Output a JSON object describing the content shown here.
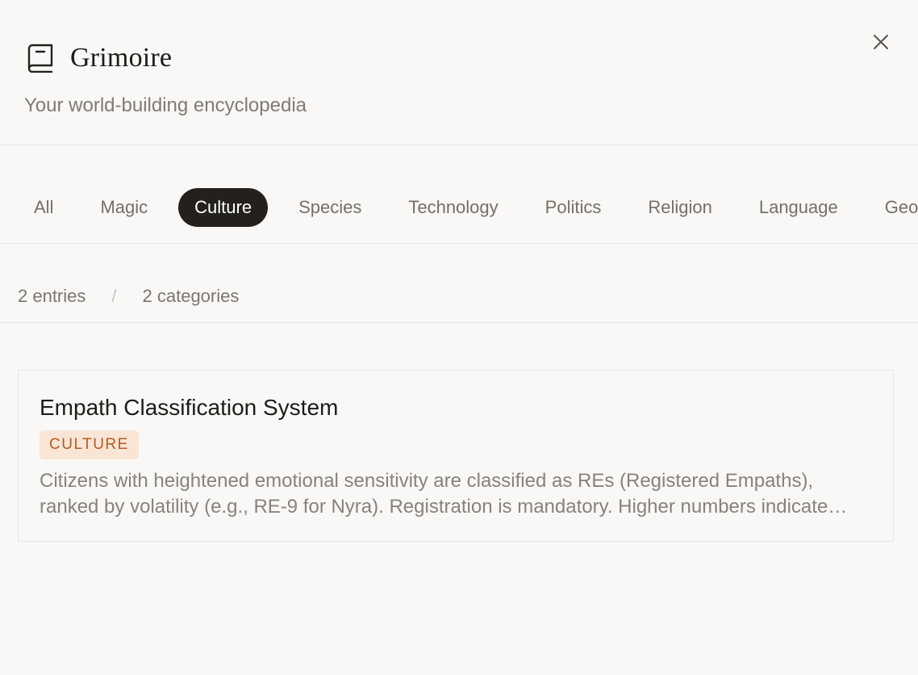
{
  "header": {
    "title": "Grimoire",
    "subtitle": "Your world-building encyclopedia",
    "brand_icon": "book-icon",
    "close_icon": "close-icon"
  },
  "tabs": [
    {
      "label": "All",
      "active": false
    },
    {
      "label": "Magic",
      "active": false
    },
    {
      "label": "Culture",
      "active": true
    },
    {
      "label": "Species",
      "active": false
    },
    {
      "label": "Technology",
      "active": false
    },
    {
      "label": "Politics",
      "active": false
    },
    {
      "label": "Religion",
      "active": false
    },
    {
      "label": "Language",
      "active": false
    },
    {
      "label": "Geography",
      "active": false
    }
  ],
  "stats": {
    "entries": "2 entries",
    "separator": "/",
    "categories": "2 categories"
  },
  "entries": [
    {
      "title": "Empath Classification System",
      "category": "CULTURE",
      "description": "Citizens with heightened emotional sensitivity are classified as REs (Registered Empaths), ranked by volatility (e.g., RE-9 for Nyra). Registration is mandatory. Higher numbers indicate greater volatility."
    }
  ],
  "colors": {
    "background": "#f9f8f6",
    "active_tab_bg": "#24211c",
    "badge_bg": "#f9e5d6",
    "badge_text": "#b45c23"
  }
}
